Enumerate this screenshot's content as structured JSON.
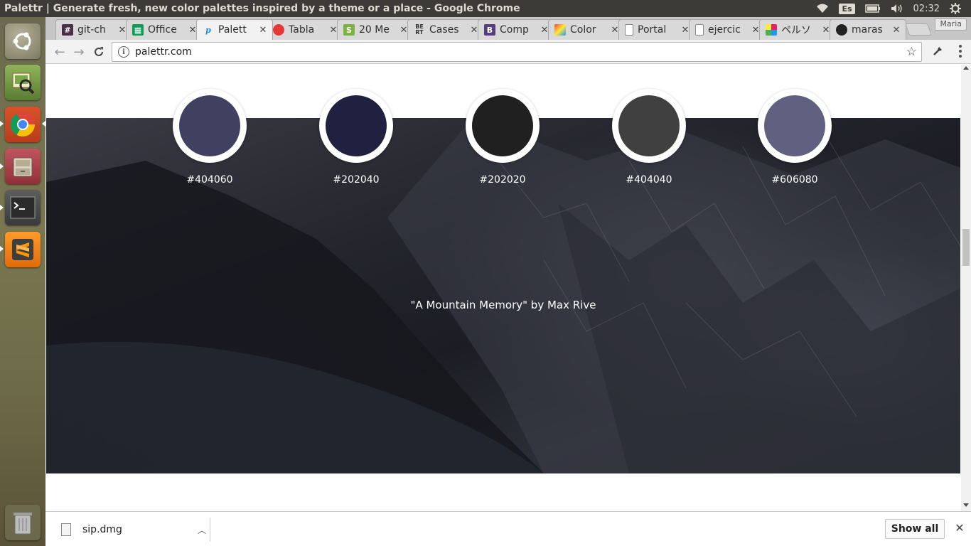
{
  "window": {
    "title": "Palettr | Generate fresh, new color palettes inspired by a theme or a place - Google Chrome"
  },
  "panel": {
    "keyboard_layout": "Es",
    "clock": "02:32"
  },
  "launcher": {
    "items": [
      {
        "name": "ubuntu-dash-icon"
      },
      {
        "name": "image-viewer-icon"
      },
      {
        "name": "chrome-icon"
      },
      {
        "name": "file-cabinet-icon"
      },
      {
        "name": "terminal-icon"
      },
      {
        "name": "sublime-text-icon"
      },
      {
        "name": "trash-icon"
      }
    ]
  },
  "tabs": [
    {
      "label": "git-ch",
      "favicon": "#",
      "fav_color": "#4a2e45",
      "active": false
    },
    {
      "label": "Office",
      "favicon": "▦",
      "fav_color": "#0f9d58",
      "active": false
    },
    {
      "label": "Palett",
      "favicon": "p",
      "fav_color": "#1e88e5",
      "active": true
    },
    {
      "label": "Tabla",
      "favicon": "●",
      "fav_color": "#e53935",
      "active": false
    },
    {
      "label": "20 Me",
      "favicon": "S",
      "fav_color": "#7cb342",
      "active": false
    },
    {
      "label": "Cases",
      "favicon": "BE",
      "fav_color": "#555555",
      "active": false
    },
    {
      "label": "Comp",
      "favicon": "B",
      "fav_color": "#563d7c",
      "active": false
    },
    {
      "label": "Color",
      "favicon": "◆",
      "fav_color": "#e64a19",
      "active": false
    },
    {
      "label": "Portal",
      "favicon": "▭",
      "fav_color": "#9e9e9e",
      "active": false
    },
    {
      "label": "ejercic",
      "favicon": "▭",
      "fav_color": "#9e9e9e",
      "active": false
    },
    {
      "label": "ペルソ",
      "favicon": "■",
      "fav_color": "#e91e63",
      "active": false
    },
    {
      "label": "maras",
      "favicon": "◉",
      "fav_color": "#222222",
      "active": false
    }
  ],
  "profile_name": "Maria",
  "omnibox": {
    "url": "palettr.com"
  },
  "page": {
    "swatches": [
      {
        "hex": "#404060",
        "color": "#404060"
      },
      {
        "hex": "#202040",
        "color": "#202040"
      },
      {
        "hex": "#202020",
        "color": "#202020"
      },
      {
        "hex": "#404040",
        "color": "#404040"
      },
      {
        "hex": "#606080",
        "color": "#606080"
      }
    ],
    "credit": "\"A Mountain Memory\" by Max Rive"
  },
  "downloads": {
    "file_name": "sip.dmg",
    "show_all_label": "Show all"
  }
}
